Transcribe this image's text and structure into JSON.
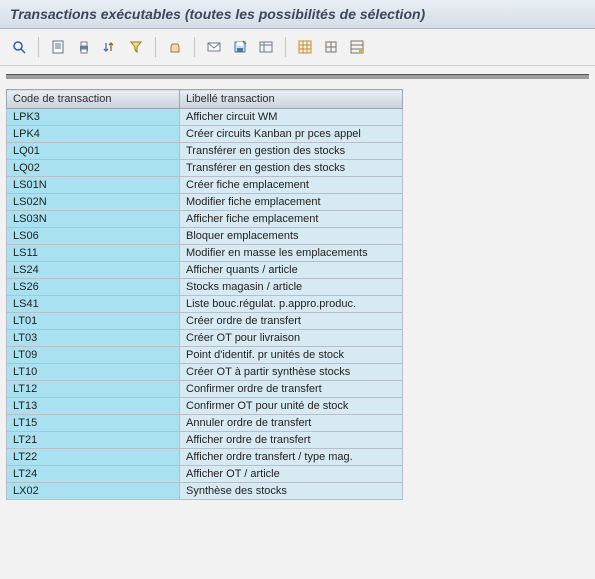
{
  "header": {
    "title": "Transactions exécutables (toutes les possibilités de sélection)"
  },
  "toolbar": {
    "details": "Détails",
    "print": "Imprimer",
    "sort": "Trier",
    "filter": "Filtrer",
    "export": "Exporter",
    "send": "Envoyer",
    "save_layout": "Enregistrer mise en forme",
    "select_layout": "Sélectionner mise en forme",
    "grid": "Grille",
    "grid_small": "Grille réduite",
    "grid_totals": "Totaux"
  },
  "table": {
    "columns": {
      "code": "Code de transaction",
      "label": "Libellé transaction"
    },
    "rows": [
      {
        "code": "LPK3",
        "label": "Afficher circuit WM"
      },
      {
        "code": "LPK4",
        "label": "Créer circuits Kanban pr pces appel"
      },
      {
        "code": "LQ01",
        "label": "Transférer en gestion des stocks"
      },
      {
        "code": "LQ02",
        "label": "Transférer en gestion des stocks"
      },
      {
        "code": "LS01N",
        "label": "Créer fiche emplacement"
      },
      {
        "code": "LS02N",
        "label": "Modifier fiche emplacement"
      },
      {
        "code": "LS03N",
        "label": "Afficher fiche emplacement"
      },
      {
        "code": "LS06",
        "label": "Bloquer emplacements"
      },
      {
        "code": "LS11",
        "label": "Modifier en masse les emplacements"
      },
      {
        "code": "LS24",
        "label": "Afficher quants / article"
      },
      {
        "code": "LS26",
        "label": "Stocks magasin / article"
      },
      {
        "code": "LS41",
        "label": "Liste bouc.régulat. p.appro.produc."
      },
      {
        "code": "LT01",
        "label": "Créer ordre de transfert"
      },
      {
        "code": "LT03",
        "label": "Créer OT pour livraison"
      },
      {
        "code": "LT09",
        "label": "Point d'identif. pr unités de stock"
      },
      {
        "code": "LT10",
        "label": "Créer OT à partir synthèse stocks"
      },
      {
        "code": "LT12",
        "label": "Confirmer ordre de transfert"
      },
      {
        "code": "LT13",
        "label": "Confirmer OT pour unité de stock"
      },
      {
        "code": "LT15",
        "label": "Annuler ordre de transfert"
      },
      {
        "code": "LT21",
        "label": "Afficher ordre de transfert"
      },
      {
        "code": "LT22",
        "label": "Afficher ordre transfert / type mag."
      },
      {
        "code": "LT24",
        "label": "Afficher OT / article"
      },
      {
        "code": "LX02",
        "label": "Synthèse des stocks"
      }
    ]
  }
}
